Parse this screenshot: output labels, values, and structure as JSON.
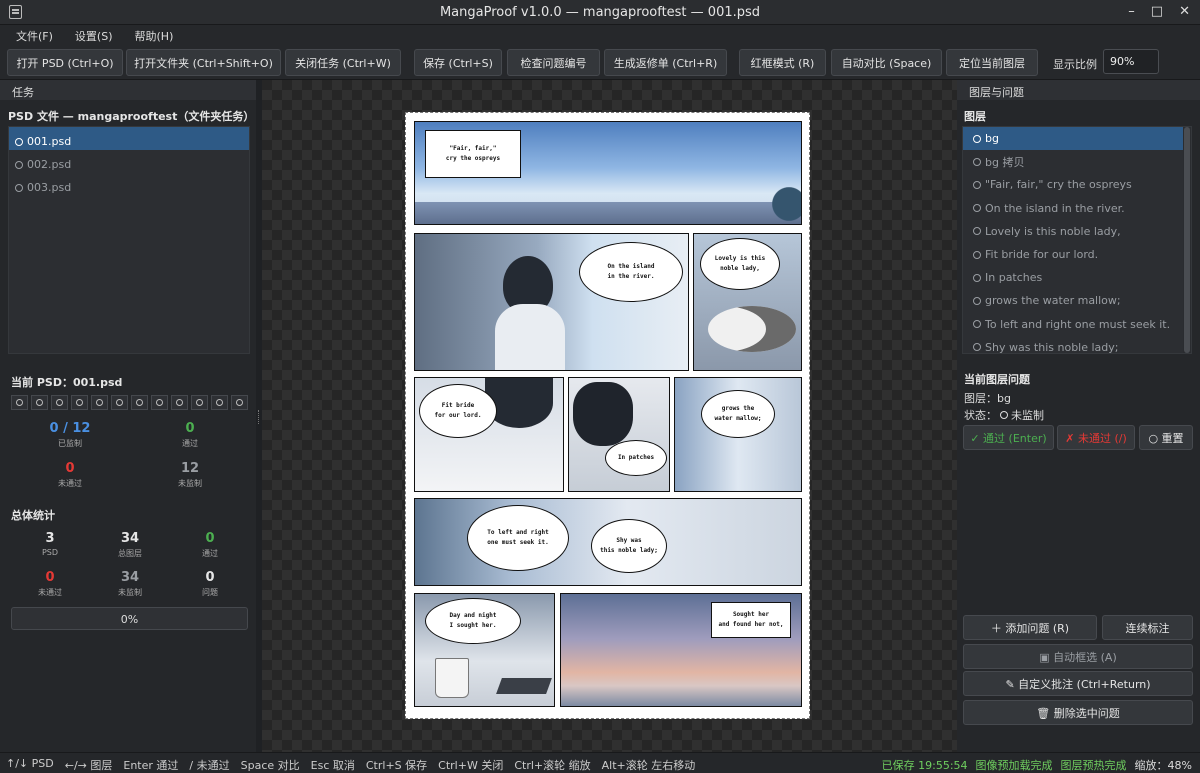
{
  "window": {
    "title": "MangaProof v1.0.0 — mangaprooftest — 001.psd",
    "controls": [
      "–",
      "□",
      "✕"
    ]
  },
  "menu": [
    "文件(F)",
    "设置(S)",
    "帮助(H)"
  ],
  "toolbar": {
    "buttons": [
      "打开 PSD (Ctrl+O)",
      "打开文件夹 (Ctrl+Shift+O)",
      "关闭任务 (Ctrl+W)",
      "保存 (Ctrl+S)",
      "检查问题编号",
      "生成返修单 (Ctrl+R)",
      "红框模式 (R)",
      "自动对比 (Space)",
      "定位当前图层"
    ],
    "zoom_label": "显示比例",
    "zoom_value": "90%"
  },
  "tasks": {
    "header": "任务",
    "section_title": "PSD 文件 — mangaprooftest（文件夹任务）",
    "files": [
      {
        "name": "001.psd",
        "selected": true
      },
      {
        "name": "002.psd",
        "selected": false
      },
      {
        "name": "003.psd",
        "selected": false
      }
    ]
  },
  "current_psd": {
    "title": "当前 PSD：001.psd",
    "layer_count": 12,
    "stats": [
      {
        "value": "0 / 12",
        "label": "已监制",
        "color": "#4a90e2"
      },
      {
        "value": "0",
        "label": "通过",
        "color": "#4caf50"
      },
      {
        "value": "0",
        "label": "未通过",
        "color": "#e53935"
      },
      {
        "value": "12",
        "label": "未监制",
        "color": "#9a9ea3"
      }
    ]
  },
  "overall": {
    "title": "总体统计",
    "stats": [
      {
        "value": "3",
        "label": "PSD",
        "color": "#e6e6e6"
      },
      {
        "value": "34",
        "label": "总图层",
        "color": "#e6e6e6"
      },
      {
        "value": "0",
        "label": "通过",
        "color": "#4caf50"
      },
      {
        "value": "0",
        "label": "未通过",
        "color": "#e53935"
      },
      {
        "value": "34",
        "label": "未监制",
        "color": "#9a9ea3"
      },
      {
        "value": "0",
        "label": "问题",
        "color": "#e6e6e6"
      }
    ],
    "progress": "0%"
  },
  "manga": {
    "p1_text": "\"Fair, fair,\"\ncry the ospreys",
    "p2a_text": "On the island\nin the river.",
    "p2b_text": "Lovely is this\nnoble lady,",
    "p3a_text": "Fit bride\nfor our lord.",
    "p3b_text": "In patches",
    "p3c_text": "grows the\nwater mallow;",
    "p4a_text": "To left and right\none must seek it.",
    "p4b_text": "Shy was\nthis noble lady;",
    "p5a_text": "Day and night\nI sought her.",
    "p5b_text": "Sought her\nand found her not,"
  },
  "layers": {
    "header": "图层与问题",
    "section_title": "图层",
    "items": [
      {
        "name": "bg",
        "selected": true
      },
      {
        "name": "bg 拷贝",
        "selected": false
      },
      {
        "name": "\"Fair, fair,\" cry the ospreys",
        "selected": false
      },
      {
        "name": "On the island  in the river.",
        "selected": false
      },
      {
        "name": "Lovely is this  noble lady,",
        "selected": false
      },
      {
        "name": "Fit bride  for our lord.",
        "selected": false
      },
      {
        "name": "In patches",
        "selected": false
      },
      {
        "name": "grows the  water mallow;",
        "selected": false
      },
      {
        "name": "To left and right  one must seek it.",
        "selected": false
      },
      {
        "name": "Shy was  this noble lady;",
        "selected": false
      }
    ]
  },
  "issue": {
    "title": "当前图层问题",
    "layer_line": "图层：bg",
    "status_label": "状态：",
    "status_value": "未监制",
    "pass_label": "✓ 通过 (Enter)",
    "fail_label": "✗ 未通过 (/)",
    "reset_label": "○ 重置",
    "add_issue": "＋ 添加问题 (R)",
    "continuous": "连续标注",
    "auto_select": "▣ 自动框选 (A)",
    "custom_note": "✎ 自定义批注 (Ctrl+Return)",
    "delete_issue": "🗑 删除选中问题"
  },
  "statusbar": {
    "hints": [
      "↑/↓ PSD",
      "←/→ 图层",
      "Enter 通过",
      "/ 未通过",
      "Space 对比",
      "Esc 取消",
      "Ctrl+S 保存",
      "Ctrl+W 关闭",
      "Ctrl+滚轮 缩放",
      "Alt+滚轮 左右移动"
    ],
    "saved": "已保存 19:55:54",
    "preload": "图像预加载完成",
    "layer_preload": "图层预热完成",
    "zoom": "缩放：48%"
  },
  "colors": {
    "accent": "#2e5a86",
    "pass": "#4caf50",
    "fail": "#e53935",
    "neutral": "#9a9ea3",
    "status_ok": "#6fcf5f"
  }
}
